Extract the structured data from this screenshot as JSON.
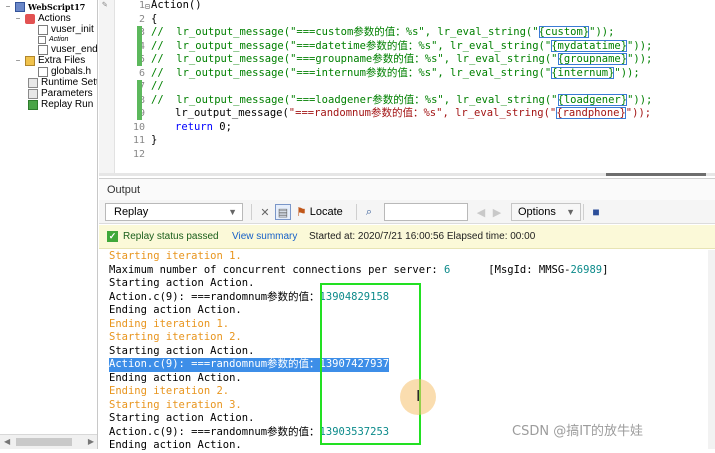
{
  "tree": {
    "root_label": "WebScript17",
    "actions_label": "Actions",
    "vuser_init": "vuser_init",
    "action_small": "Action",
    "vuser_end": "vuser_end",
    "extra_files": "Extra Files",
    "globals": "globals.h",
    "runtime": "Runtime Settings",
    "parameters": "Parameters",
    "replay_run": "Replay Run"
  },
  "editor": {
    "lines": [
      {
        "num": "1",
        "text": "Action()"
      },
      {
        "num": "2",
        "text": "{"
      },
      {
        "num": "3",
        "pre": "//  lr_output_message(\"===custom参数的值：%s\", lr_eval_string(\"",
        "param": "{custom}",
        "post": "\"));"
      },
      {
        "num": "4",
        "pre": "//  lr_output_message(\"===datetime参数的值：%s\", lr_eval_string(\"",
        "param": "{mydatatime}",
        "post": "\"));"
      },
      {
        "num": "5",
        "pre": "//  lr_output_message(\"===groupname参数的值：%s\", lr_eval_string(\"",
        "param": "{groupname}",
        "post": "\"));"
      },
      {
        "num": "6",
        "pre": "//  lr_output_message(\"===internum参数的值：%s\", lr_eval_string(\"",
        "param": "{internum}",
        "post": "\"));"
      },
      {
        "num": "7",
        "text": "//"
      },
      {
        "num": "8",
        "pre": "//  lr_output_message(\"===loadgener参数的值：%s\", lr_eval_string(\"",
        "param": "{loadgener}",
        "post": "\"));"
      },
      {
        "num": "9",
        "fn": "lr_output_message(",
        "str1": "\"===randomnum参数的值：%s\"",
        "mid": ", lr_eval_string(\"",
        "param": "{randphone}",
        "post": "\"));"
      },
      {
        "num": "10",
        "kw": "return",
        "rest": " 0;"
      },
      {
        "num": "11",
        "text": "}"
      },
      {
        "num": "12",
        "text": ""
      }
    ]
  },
  "output": {
    "title": "Output",
    "replay_option": "Replay",
    "locate_label": "Locate",
    "search_value": "",
    "options_label": "Options",
    "status_text": "Replay status passed",
    "view_summary": "View summary",
    "started": "Started at: 2020/7/21 16:00:56 Elapsed time: 00:00"
  },
  "log": {
    "l1": "Starting iteration 1.",
    "l2a": "Maximum number of concurrent connections per server: ",
    "l2b": "6",
    "l2c": "      [MsgId: MMSG-",
    "l2d": "26989",
    "l2e": "]",
    "l3": "Starting action Action.",
    "l4a": "Action.c(9): ===randomnum参数的值：",
    "l4b": "13904829158",
    "l5": "Ending action Action.",
    "l6": "Ending iteration 1.",
    "l7": "Starting iteration 2.",
    "l8": "Starting action Action.",
    "l9": "Action.c(9): ===randomnum参数的值：13907427937",
    "l10": "Ending action Action.",
    "l11": "Ending iteration 2.",
    "l12": "Starting iteration 3.",
    "l13": "Starting action Action.",
    "l14a": "Action.c(9): ===randomnum参数的值：",
    "l14b": "13903537253",
    "l15": "Ending action Action."
  },
  "watermark": "CSDN @搞IT的放牛娃",
  "colors": {
    "highlight_box": "#22e022",
    "selection": "#3d8ee8",
    "status_bg": "#fbf9d8"
  }
}
